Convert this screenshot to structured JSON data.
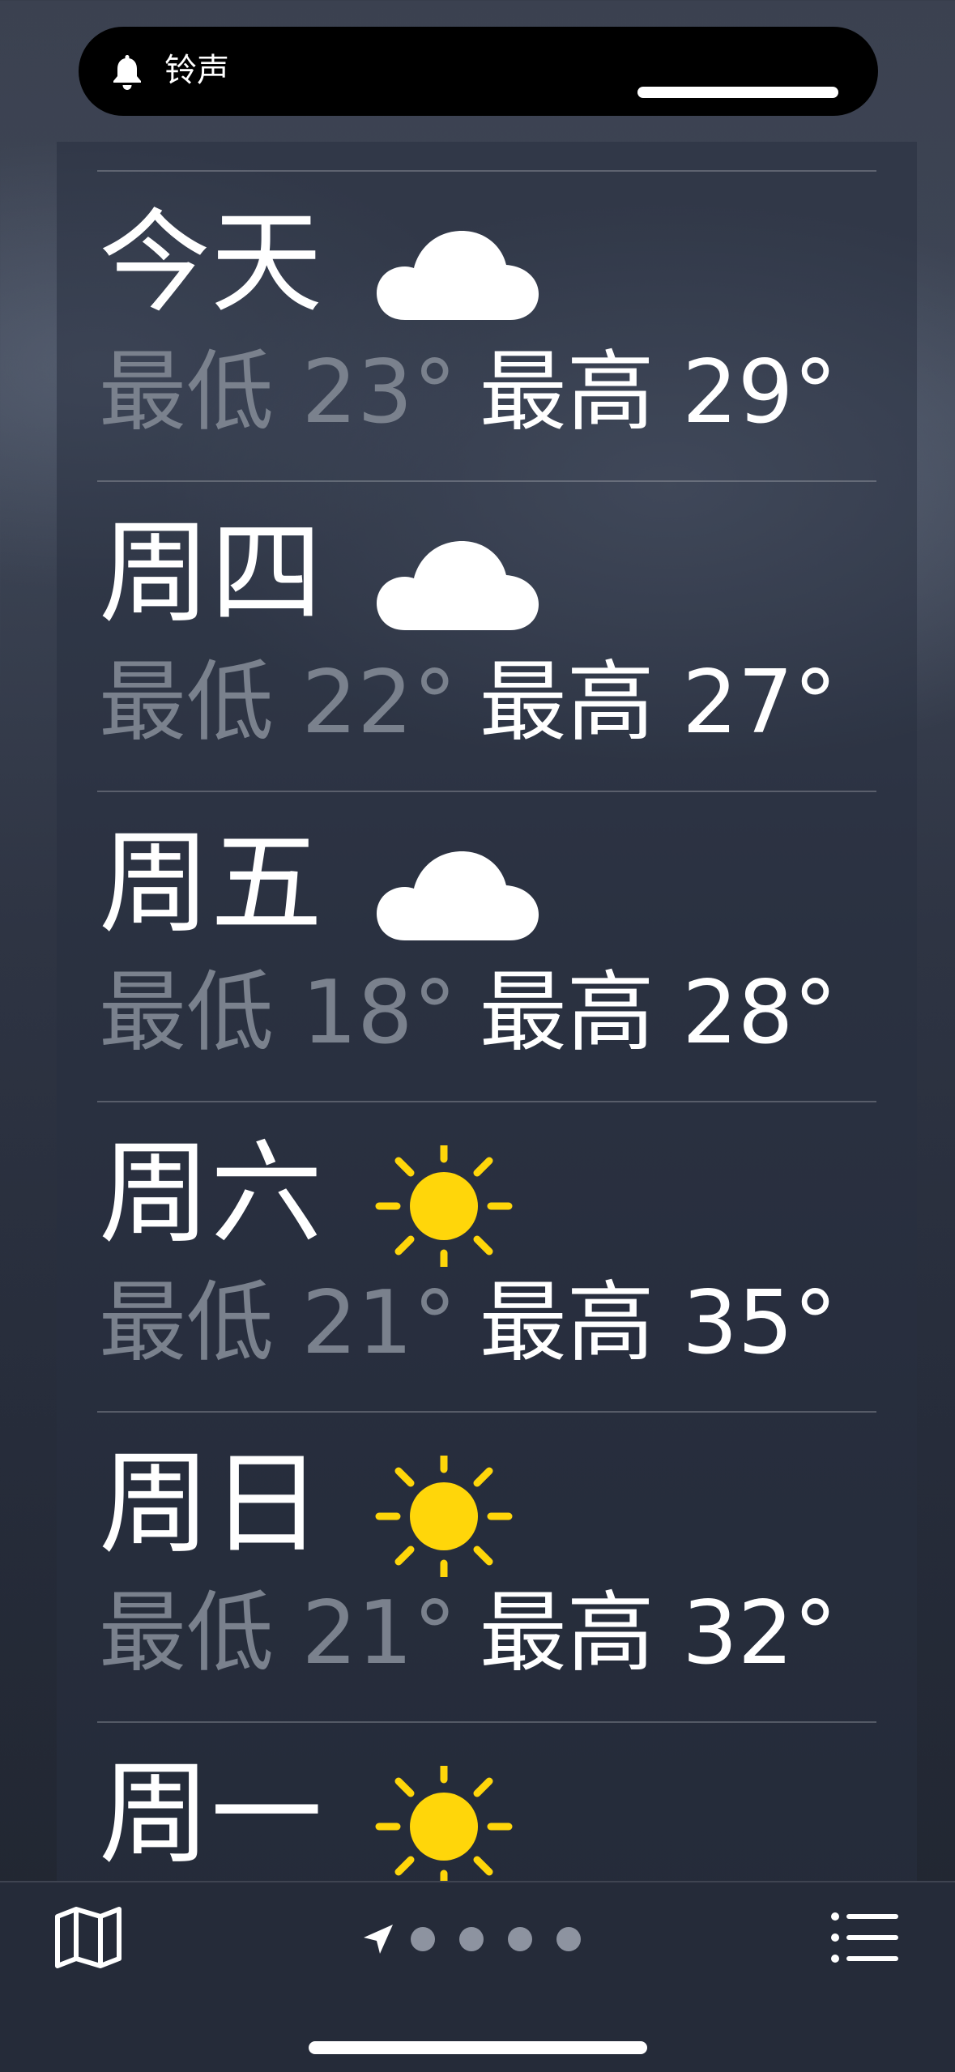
{
  "ringer": {
    "label": "铃声",
    "icon": "bell-icon",
    "volume_level": 1.0
  },
  "forecast": [
    {
      "day": "今天",
      "condition": "cloud-icon",
      "low_label": "最低 23°",
      "high_label": "最高 29°"
    },
    {
      "day": "周四",
      "condition": "cloud-icon",
      "low_label": "最低 22°",
      "high_label": "最高 27°"
    },
    {
      "day": "周五",
      "condition": "cloud-icon",
      "low_label": "最低 18°",
      "high_label": "最高 28°"
    },
    {
      "day": "周六",
      "condition": "sun-icon",
      "low_label": "最低 21°",
      "high_label": "最高 35°"
    },
    {
      "day": "周日",
      "condition": "sun-icon",
      "low_label": "最低 21°",
      "high_label": "最高 32°"
    },
    {
      "day": "周一",
      "condition": "sun-icon"
    }
  ],
  "bottom_bar": {
    "map_icon": "map-icon",
    "location_icon": "location-arrow-icon",
    "page_count": 4,
    "list_icon": "list-icon"
  },
  "colors": {
    "low_temp": "#7a818d",
    "high_temp": "#ffffff",
    "sun": "#ffd60a",
    "cloud": "#ffffff"
  }
}
